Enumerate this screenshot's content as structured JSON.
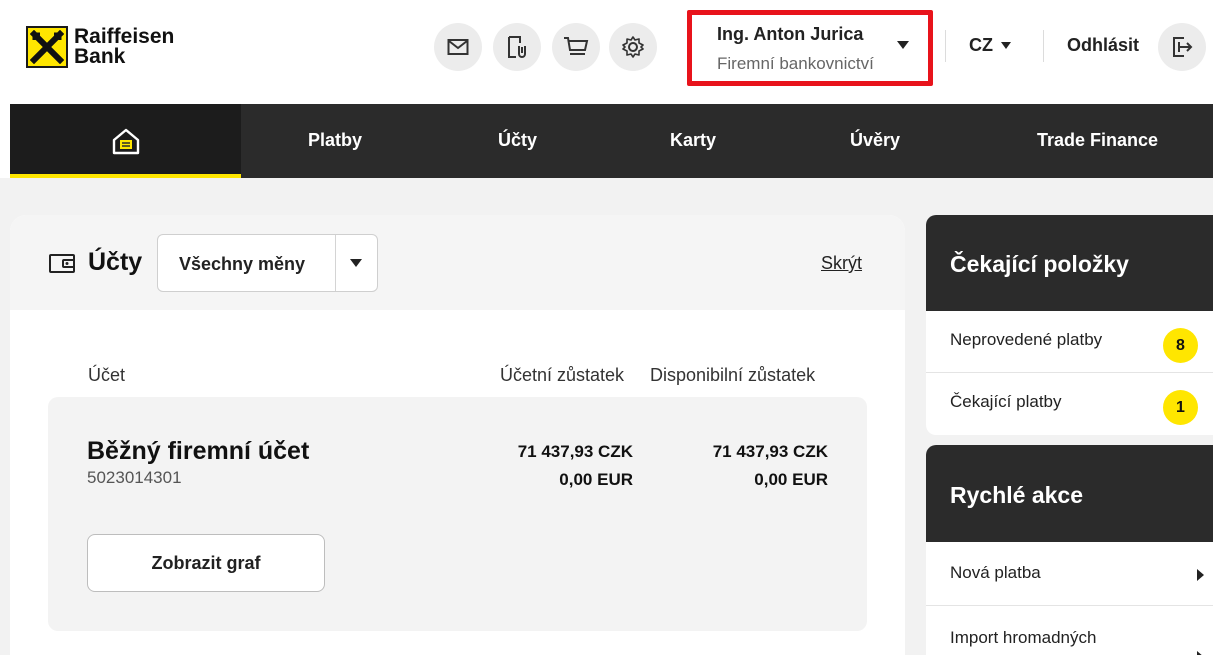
{
  "brand": {
    "line1": "Raiffeisen",
    "line2": "Bank"
  },
  "header": {
    "icons": [
      "mail-icon",
      "document-attachment-icon",
      "cart-icon",
      "gear-icon"
    ],
    "user": {
      "name": "Ing. Anton Jurica",
      "role": "Firemní bankovnictví"
    },
    "language": "CZ",
    "logout_label": "Odhlásit",
    "highlight_color": "#e8131b"
  },
  "nav": {
    "items": [
      "Platby",
      "Účty",
      "Karty",
      "Úvěry",
      "Trade Finance"
    ],
    "accent_color": "#ffe600"
  },
  "accounts": {
    "title": "Účty",
    "currency_filter": "Všechny měny",
    "hide_label": "Skrýt",
    "columns": {
      "account": "Účet",
      "booked": "Účetní zůstatek",
      "available": "Disponibilní zůstatek"
    },
    "rows": [
      {
        "name": "Běžný firemní účet",
        "number": "5023014301",
        "booked": [
          "71 437,93 CZK",
          "0,00 EUR"
        ],
        "available": [
          "71 437,93 CZK",
          "0,00 EUR"
        ],
        "graph_label": "Zobrazit graf"
      }
    ]
  },
  "pending": {
    "title": "Čekající položky",
    "items": [
      {
        "label": "Neprovedené platby",
        "count": "8"
      },
      {
        "label": "Čekající platby",
        "count": "1"
      }
    ]
  },
  "quick_actions": {
    "title": "Rychlé akce",
    "items": [
      "Nová platba",
      "Import hromadných"
    ]
  }
}
